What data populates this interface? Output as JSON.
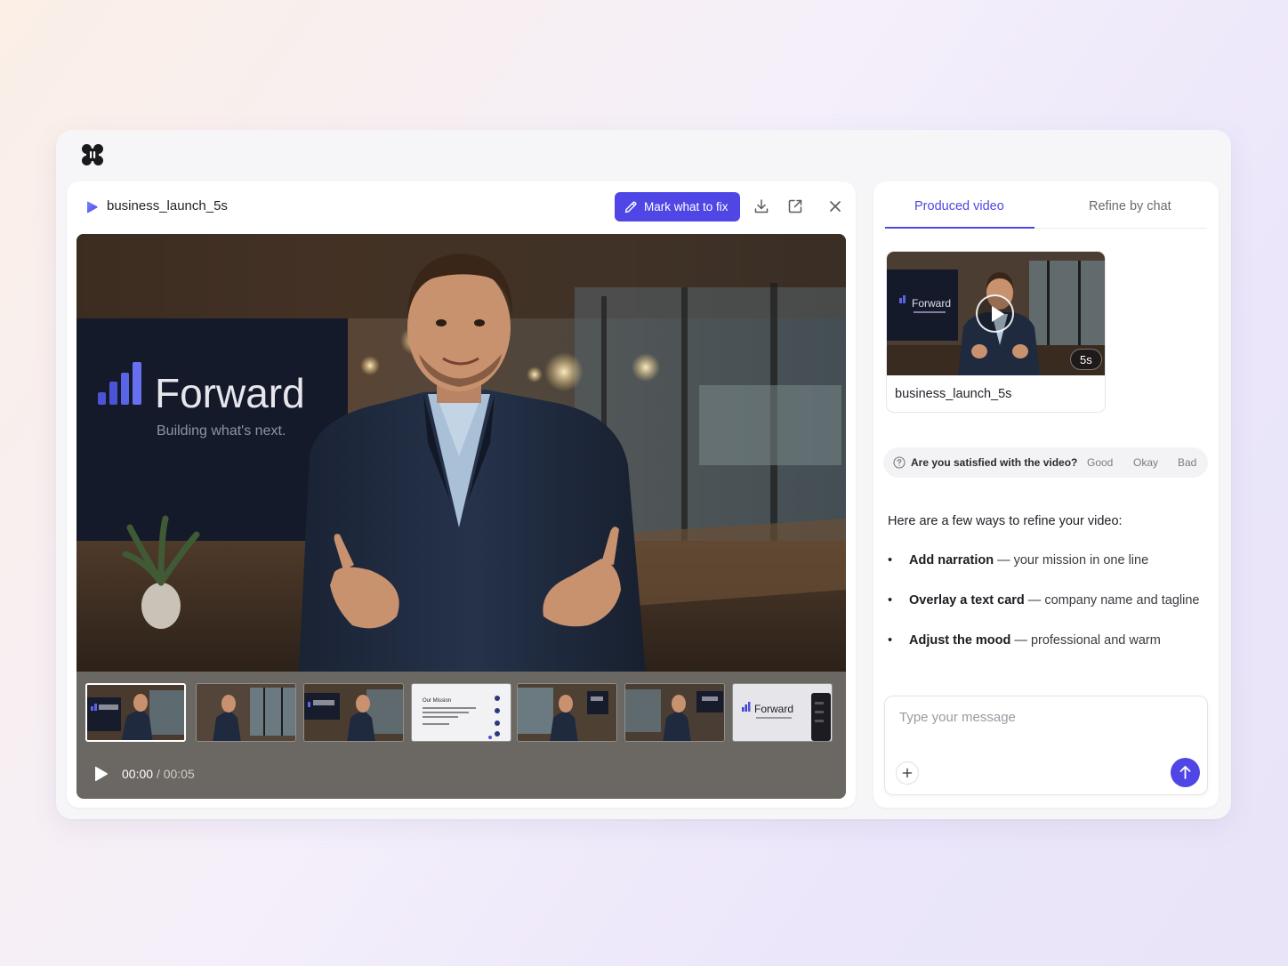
{
  "app": {
    "logo_icon": "app-logo-icon"
  },
  "viewer": {
    "file_title": "business_launch_5s",
    "mark_button_label": "Mark what to fix",
    "actions": [
      "download-icon",
      "open-external-icon",
      "close-icon"
    ],
    "video": {
      "scene": "man in suit presenting in office",
      "wall_brand": "Forward",
      "wall_tagline": "Building what's next"
    },
    "filmstrip": [
      {
        "kind": "presenter",
        "sign": "Forward",
        "active": true
      },
      {
        "kind": "presenter",
        "sign": "",
        "active": false
      },
      {
        "kind": "presenter",
        "sign": "Forward",
        "active": false
      },
      {
        "kind": "slide",
        "heading": "Our Mission",
        "active": false
      },
      {
        "kind": "presenter",
        "sign": "Forward",
        "active": false
      },
      {
        "kind": "presenter",
        "sign": "Forward",
        "active": false
      },
      {
        "kind": "title-card",
        "heading": "Forward",
        "active": false
      }
    ],
    "time_current": "00:00",
    "time_separator": "/",
    "time_total": "00:05"
  },
  "sidebar": {
    "tabs": [
      {
        "label": "Produced video",
        "active": true
      },
      {
        "label": "Refine by chat",
        "active": false
      }
    ],
    "video_card": {
      "name": "business_launch_5s",
      "duration": "5s",
      "thumb_brand": "Forward"
    },
    "feedback": {
      "question": "Are you satisfied with the video?",
      "options": [
        "Good",
        "Okay",
        "Bad"
      ]
    },
    "intro": "Here are a few ways to refine your video:",
    "suggestions": [
      {
        "title": "Add narration",
        "detail": " — your mission in one line"
      },
      {
        "title": "Overlay a text card",
        "detail": " — company name and tagline"
      },
      {
        "title": "Adjust the mood",
        "detail": " — professional and warm"
      }
    ],
    "composer": {
      "placeholder": "Type your message",
      "value": ""
    }
  },
  "colors": {
    "accent": "#4f46e5",
    "panel": "#ffffff",
    "window": "#f6f6f8"
  }
}
